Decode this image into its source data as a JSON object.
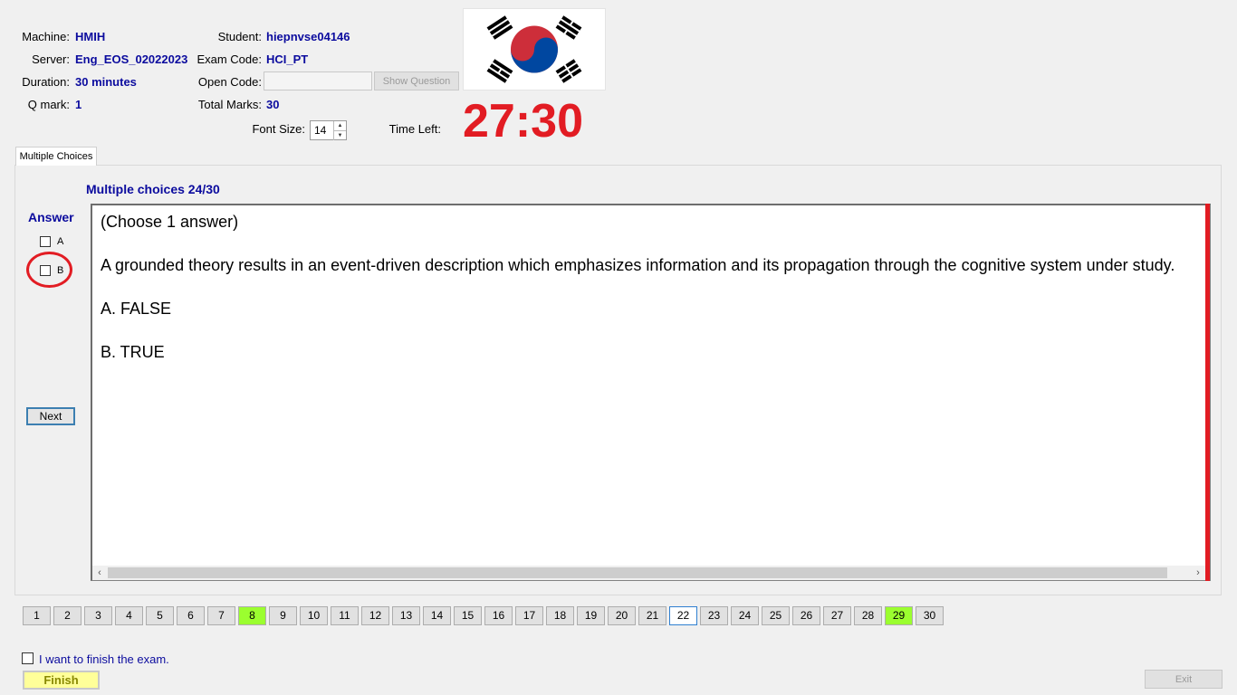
{
  "header": {
    "machine_label": "Machine:",
    "machine": "HMIH",
    "server_label": "Server:",
    "server": "Eng_EOS_02022023",
    "duration_label": "Duration:",
    "duration": "30 minutes",
    "qmark_label": "Q mark:",
    "qmark": "1",
    "student_label": "Student:",
    "student": "hiepnvse04146",
    "exam_code_label": "Exam Code:",
    "exam_code": "HCI_PT",
    "open_code_label": "Open Code:",
    "open_code_value": "",
    "show_question_label": "Show Question",
    "total_marks_label": "Total Marks:",
    "total_marks": "30",
    "font_size_label": "Font Size:",
    "font_size": "14",
    "time_left_label": "Time Left:",
    "time_left": "27:30"
  },
  "tab": {
    "label": "Multiple Choices"
  },
  "question": {
    "title": "Multiple choices 24/30",
    "instruction": "(Choose 1 answer)",
    "text": "A grounded theory results in an event-driven description which emphasizes information and its propagation through the cognitive system under study.",
    "options": [
      "A.  FALSE",
      "B.  TRUE"
    ]
  },
  "answer": {
    "title": "Answer",
    "choices": [
      {
        "letter": "A",
        "checked": false
      },
      {
        "letter": "B",
        "checked": false
      }
    ],
    "next_label": "Next"
  },
  "navigation": {
    "numbers": [
      "1",
      "2",
      "3",
      "4",
      "5",
      "6",
      "7",
      "8",
      "9",
      "10",
      "11",
      "12",
      "13",
      "14",
      "15",
      "16",
      "17",
      "18",
      "19",
      "20",
      "21",
      "22",
      "23",
      "24",
      "25",
      "26",
      "27",
      "28",
      "29",
      "30"
    ],
    "answered": [
      "8",
      "29"
    ],
    "current": "22",
    "answered_color": "#9bfe2f"
  },
  "footer": {
    "finish_checkbox_label": "I want to finish the exam.",
    "finish_label": "Finish",
    "exit_label": "Exit"
  },
  "colors": {
    "timer": "#e21c23",
    "value_text": "#0b0b9e"
  },
  "icons": {
    "flag": "south-korea-flag-icon"
  }
}
